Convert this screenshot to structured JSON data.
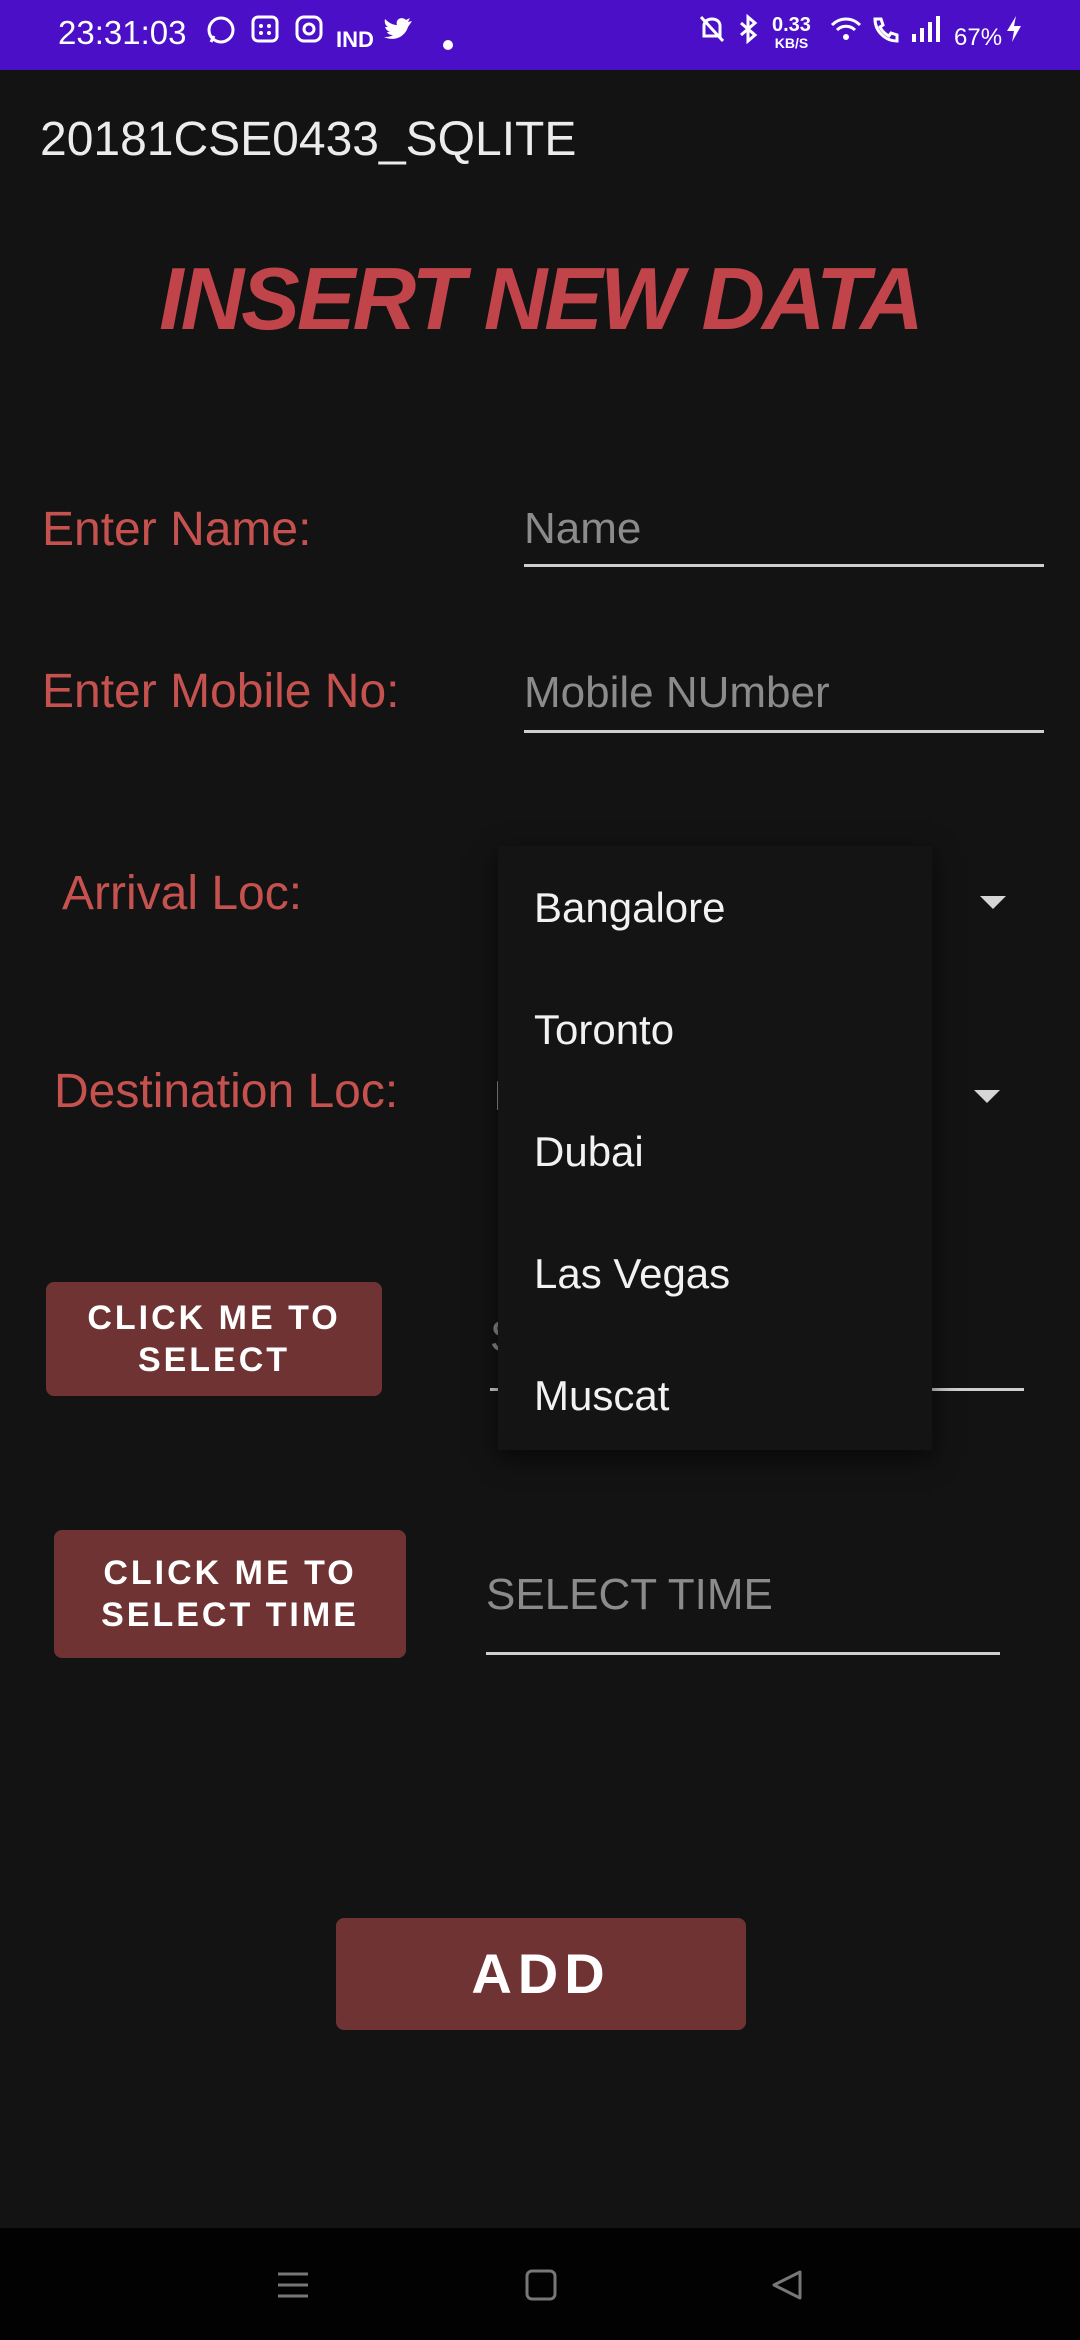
{
  "status_bar": {
    "time": "23:31:03",
    "net_speed_value": "0.33",
    "net_speed_unit": "KB/S",
    "battery": "67%",
    "left_icons": [
      "whatsapp-icon",
      "calculator-icon",
      "instagram-icon",
      "ind-icon",
      "twitter-icon",
      "dot-icon"
    ],
    "right_icons": [
      "mute-icon",
      "bluetooth-icon",
      "wifi-icon",
      "wifi-calling-icon",
      "signal-icon",
      "charging-icon"
    ],
    "ind_text": "IND"
  },
  "app": {
    "title": "20181CSE0433_SQLITE"
  },
  "form": {
    "heading": "INSERT NEW DATA",
    "name_label": "Enter Name:",
    "name_placeholder": "Name",
    "mobile_label": "Enter Mobile No:",
    "mobile_placeholder": "Mobile NUmber",
    "arrival_label": "Arrival Loc:",
    "destination_label": "Destination Loc:",
    "destination_value_partial": "M",
    "date_button": "CLICK ME TO SELECT",
    "date_placeholder_partial": "S",
    "time_button": "CLICK ME TO SELECT TIME",
    "time_placeholder": "SELECT TIME",
    "add_button": "ADD"
  },
  "dropdown": {
    "options": [
      "Bangalore",
      "Toronto",
      "Dubai",
      "Las Vegas",
      "Muscat"
    ]
  }
}
